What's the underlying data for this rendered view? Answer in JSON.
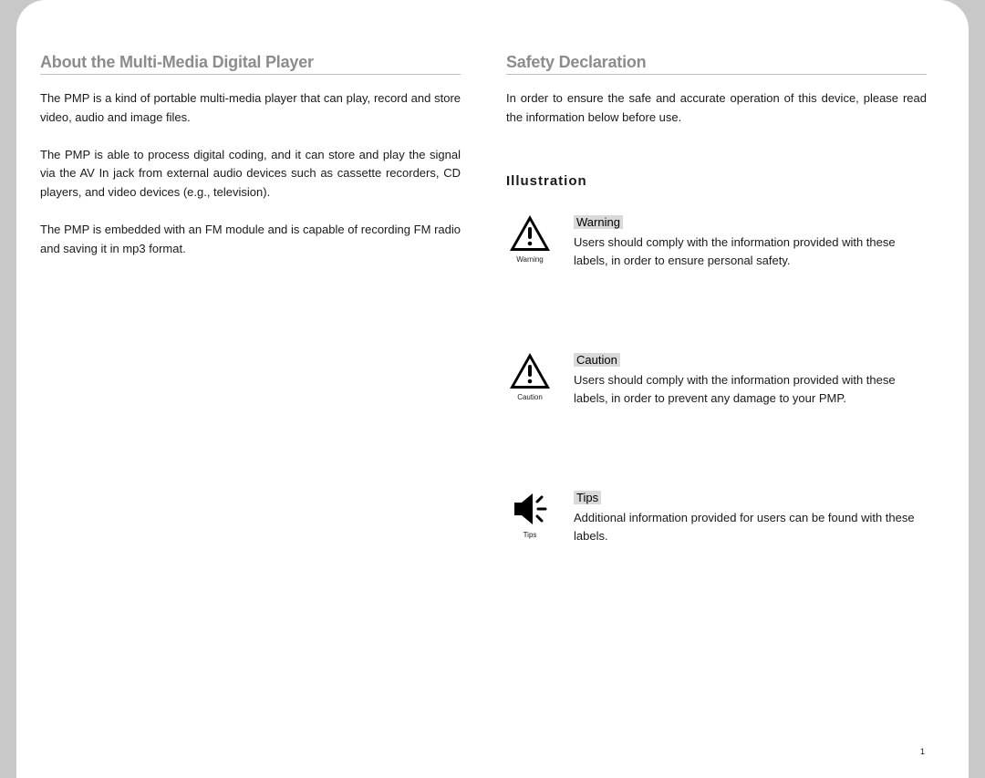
{
  "left": {
    "heading": "About the Multi-Media Digital Player",
    "p1": "The PMP is a kind of portable multi-media player that can play, record and store video, audio and image files.",
    "p2": "The PMP is able to process digital coding, and it can store and play the signal via the AV In jack from external audio devices such as cassette recorders, CD players, and video devices (e.g., television).",
    "p3": "The PMP is embedded with an FM module and is capable of recording FM radio and saving it in mp3 format."
  },
  "right": {
    "heading": "Safety Declaration",
    "intro": "In order to ensure the safe and accurate operation of this device, please read the information below before use.",
    "subheading": "Illustration",
    "items": [
      {
        "caption": "Warning",
        "label": "Warning",
        "desc": "Users should comply with the information provided with these labels, in order to ensure personal safety."
      },
      {
        "caption": "Caution",
        "label": "Caution",
        "desc": "Users should comply with the information provided with these labels, in order to prevent any damage to your PMP."
      },
      {
        "caption": "Tips",
        "label": "Tips",
        "desc": "Additional information provided for users can be found with these labels."
      }
    ]
  },
  "page_number": "1"
}
